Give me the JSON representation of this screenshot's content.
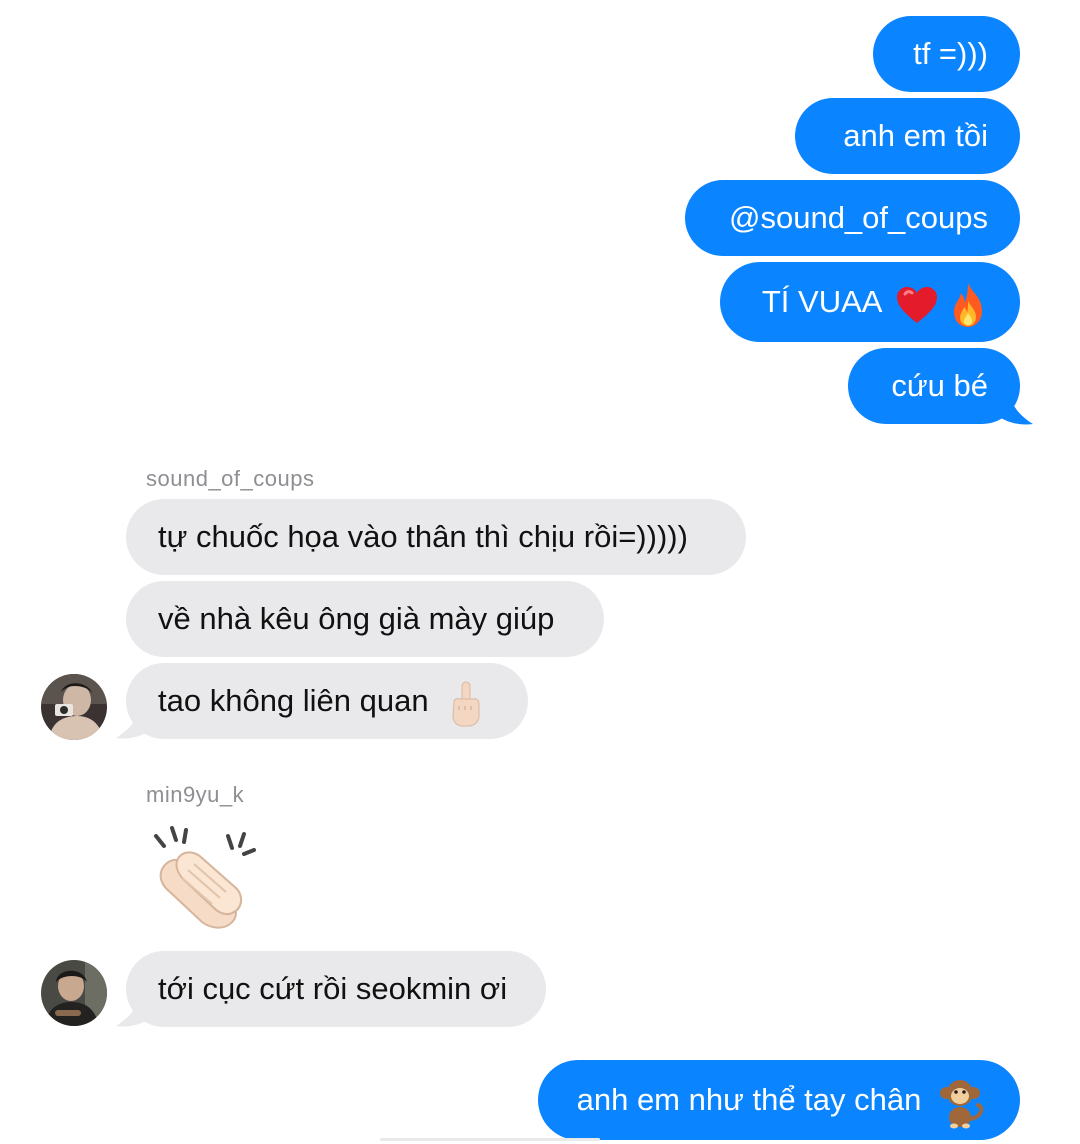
{
  "thread": {
    "messages": [
      {
        "id": "m1",
        "direction": "outgoing",
        "text": "tf =)))"
      },
      {
        "id": "m2",
        "direction": "outgoing",
        "text": "anh em tồi"
      },
      {
        "id": "m3",
        "direction": "outgoing",
        "text": "@sound_of_coups"
      },
      {
        "id": "m4",
        "direction": "outgoing",
        "text": "TÍ VUAA",
        "emojis": [
          "red-heart",
          "fire"
        ]
      },
      {
        "id": "m5",
        "direction": "outgoing",
        "text": "cứu bé"
      },
      {
        "id": "m6",
        "direction": "incoming",
        "sender": "sound_of_coups",
        "text": "tự chuốc họa vào thân thì chịu rồi=)))))"
      },
      {
        "id": "m7",
        "direction": "incoming",
        "sender": "sound_of_coups",
        "text": "về nhà kêu ông già mày giúp"
      },
      {
        "id": "m8",
        "direction": "incoming",
        "sender": "sound_of_coups",
        "text": "tao không liên quan",
        "emojis": [
          "middle-finger"
        ]
      },
      {
        "id": "m9",
        "direction": "incoming",
        "sender": "min9yu_k",
        "emojis": [
          "clapping-hands"
        ]
      },
      {
        "id": "m10",
        "direction": "incoming",
        "sender": "min9yu_k",
        "text": "tới cục cứt rồi seokmin ơi"
      },
      {
        "id": "m11",
        "direction": "outgoing",
        "text": "anh em như thể tay chân",
        "emojis": [
          "monkey"
        ]
      }
    ],
    "senders": [
      "sound_of_coups",
      "min9yu_k"
    ]
  },
  "colors": {
    "outgoing_bubble": "#0a84ff",
    "incoming_bubble": "#e9e9eb",
    "sender_label": "#8e8e93"
  }
}
